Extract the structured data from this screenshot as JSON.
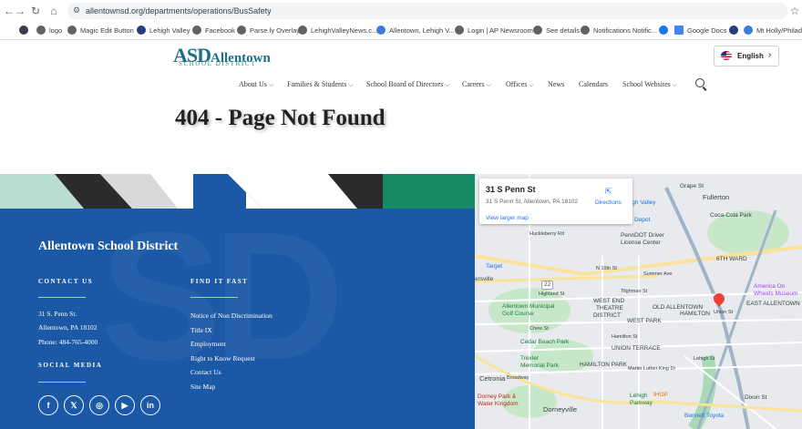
{
  "browser": {
    "url": "allentownsd.org/departments/operations/BusSafety",
    "bookmarks": [
      {
        "label": "",
        "color": "#3b3b4f"
      },
      {
        "label": "logo",
        "color": "#5f6368"
      },
      {
        "label": "Magic Edit Button",
        "color": "#5f6368"
      },
      {
        "label": "Lehigh Valley",
        "color": "#2a3d7c"
      },
      {
        "label": "Facebook",
        "color": "#5f6368"
      },
      {
        "label": "Parse.ly Overlay",
        "color": "#5f6368"
      },
      {
        "label": "LehighValleyNews.c...",
        "color": "#5f6368"
      },
      {
        "label": "Allentown, Lehigh V...",
        "color": "#3b7ddd"
      },
      {
        "label": "Login | AP Newsroom",
        "color": "#5f6368"
      },
      {
        "label": "See details",
        "color": "#5f6368"
      },
      {
        "label": "Notifications Notific...",
        "color": "#5f6368"
      },
      {
        "label": "",
        "color": "#1877f2"
      },
      {
        "label": "Google Docs",
        "color": "#4285f4"
      },
      {
        "label": "",
        "color": "#2a3d7c"
      },
      {
        "label": "Mt Holly/Philade",
        "color": "#3b7ddd"
      }
    ]
  },
  "header": {
    "logo_abbr": "ASD",
    "logo_name": "Allentown",
    "logo_sub": "SCHOOL DISTRICT",
    "language": "English",
    "nav": [
      {
        "label": "About Us",
        "dropdown": true
      },
      {
        "label": "Families & Students",
        "dropdown": true
      },
      {
        "label": "School Board of Directors",
        "dropdown": true
      },
      {
        "label": "Careers",
        "dropdown": true
      },
      {
        "label": "Offices",
        "dropdown": true
      },
      {
        "label": "News",
        "dropdown": false
      },
      {
        "label": "Calendars",
        "dropdown": false
      },
      {
        "label": "School Websites",
        "dropdown": true
      }
    ]
  },
  "main": {
    "title": "404 - Page Not Found"
  },
  "footer": {
    "school_name": "Allentown School District",
    "contact_heading": "CONTACT US",
    "address_line1": "31 S. Penn St.",
    "address_line2": "Allentown, PA  18102",
    "phone": "Phone: 484-765-4000",
    "social_heading": "SOCIAL MEDIA",
    "social_icons": [
      "facebook-icon",
      "x-icon",
      "instagram-icon",
      "youtube-icon",
      "linkedin-icon"
    ],
    "find_heading": "FIND IT FAST",
    "links": [
      "Notice of Non Discrimination",
      "Title IX",
      "Employment",
      "Right to Know Request",
      "Contact Us",
      "Site Map"
    ],
    "colors": {
      "blue": "#1b58a6",
      "teal": "#b9ddd3",
      "dark": "#2b2b2b",
      "gray": "#d9d9d9",
      "green": "#158a64"
    }
  },
  "map": {
    "place_name": "31 S Penn St",
    "place_address": "31 S Penn St, Allentown, PA 18102",
    "directions_label": "Directions",
    "larger_map_label": "View larger map",
    "labels": [
      "Fullerton",
      "Coca-Cola Park",
      "Grape St",
      "Lehigh Valley",
      "Depot",
      "PennDOT Driver",
      "License Center",
      "Target",
      "ersville",
      "6TH WARD",
      "America On",
      "Wheels Museum",
      "Allentown Municipal",
      "Golf Course",
      "WEST END",
      "THEATRE",
      "DISTRICT",
      "OLD ALLENTOWN",
      "HAMILTON",
      "WEST PARK",
      "EAST ALLENTOWN",
      "Cedar Beach Park",
      "UNION TERRACE",
      "Trexler",
      "Memorial Park",
      "HAMILTON PARK",
      "Cetronia",
      "Dorney Park &",
      "Water Kingdom",
      "Dorneyville",
      "Lehigh",
      "Parkway",
      "IHOP",
      "Bennett Toyota",
      "Union St",
      "Dixon St",
      "Broadway",
      "Highland St",
      "Tilghman St",
      "Chew St",
      "Hamilton St",
      "Lehigh St",
      "Huckleberry Rd",
      "Summer Ave",
      "Martin Luther King Dr",
      "22",
      "N 19th St"
    ]
  }
}
